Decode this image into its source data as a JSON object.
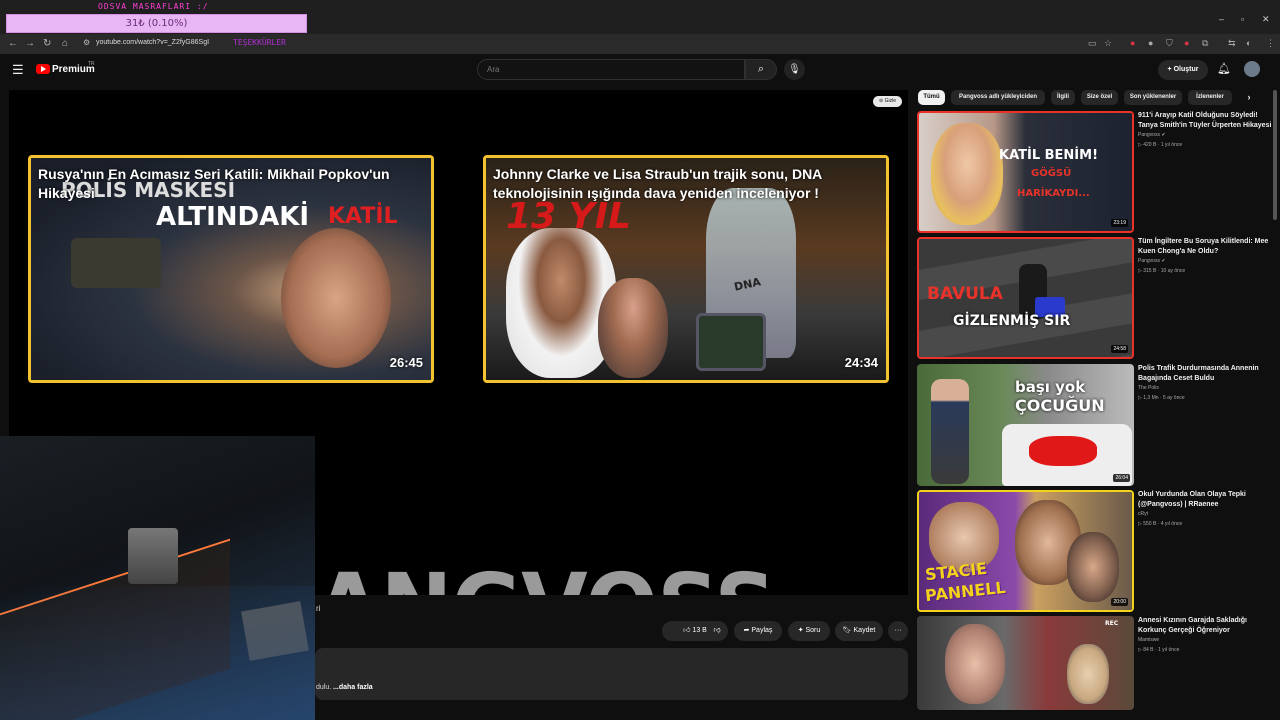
{
  "browser": {
    "overlay_title": "ODSVA MASRAFLARI :/",
    "overlay_progress": "31₺ (0.10%)",
    "overlay_progress_fraction": 0.001,
    "url": "youtube.com/watch?v=_Z2fyG86SgI",
    "url_overlay": "TEŞEKKÜRLER",
    "window_buttons": [
      "–",
      "▫",
      "✕"
    ]
  },
  "header": {
    "logo_text": "Premium",
    "logo_region": "TR",
    "search_placeholder": "Ara",
    "create_label": "Oluştur"
  },
  "player": {
    "hide_label": "Gizle",
    "watermark": "ANGVOSS",
    "endcards": [
      {
        "title": "Rusya'nın En Acımasız Seri Katili: Mikhail Popkov'un Hikayesi",
        "duration": "26:45",
        "art_text_1": "POLİS MASKESİ",
        "art_text_2": "ALTINDAKİ",
        "art_text_3": "KATİL"
      },
      {
        "title": "Johnny Clarke ve Lisa Straub'un trajik sonu, DNA teknolojisinin ışığında dava yeniden inceleniyor !",
        "duration": "24:34",
        "art_text_1": "13 YIL",
        "art_text_2": "DNA"
      }
    ]
  },
  "below_player": {
    "owner_fragment": "ri",
    "like_count": "13 B",
    "share_label": "Paylaş",
    "ask_label": "Soru",
    "save_label": "Kaydet",
    "more_label": "···",
    "desc_fragment": "dulu.",
    "desc_more": "...daha fazla"
  },
  "sidebar": {
    "chips": [
      "Tümü",
      "Pangvoss adlı yükleyiciden",
      "İlgili",
      "Size özel",
      "Son yüklenenler",
      "İzlenenler"
    ],
    "items": [
      {
        "title": "911'i Arayıp Katil Olduğunu Söyledi! Tanya Smith'in Tüyler Ürperten Hikayesi",
        "channel": "Pangvoss ✔",
        "meta": "▷ 420 B  ·  1 yıl önce",
        "duration": "23:19",
        "thumb_text_1": "KATİL BENİM!",
        "thumb_text_2": "GÖĞSÜ",
        "thumb_text_3": "HARİKAYDI..."
      },
      {
        "title": "Tüm İngiltere Bu Soruya Kilitlendi: Mee Kuen Chong'a Ne Oldu?",
        "channel": "Pangvoss ✔",
        "meta": "▷ 315 B  ·  10 ay önce",
        "duration": "24:58",
        "thumb_text_1": "BAVULA",
        "thumb_text_2": "GİZLENMİŞ SIR"
      },
      {
        "title": "Polis Trafik Durdurmasında Annenin Bagajında Ceset Buldu",
        "channel": "The Polis",
        "meta": "▷ 1,3 Mn  ·  5 ay önce",
        "duration": "26:04",
        "thumb_text_1": "başı yok",
        "thumb_text_2": "ÇOCUĞUN"
      },
      {
        "title": "Okul Yurdunda Olan Olaya Tepki (@Pangvoss) | RRaenee",
        "channel": "cRyt",
        "meta": "▷ 550 B  ·  4 yıl önce",
        "duration": "20:00",
        "thumb_text_1": "STACIE",
        "thumb_text_2": "PANNELL"
      },
      {
        "title": "Annesi Kızının Garajda Sakladığı Korkunç Gerçeği Öğreniyor",
        "channel": "Mamiswe",
        "meta": "▷ 84 B  ·  1 yıl önce",
        "duration": "",
        "thumb_text_1": "REC"
      }
    ]
  },
  "colors": {
    "background": "#0f0f0f",
    "endcard_border": "#f2c230",
    "youtube_red": "#ff0000",
    "overlay_pink": "#e8b6f2"
  }
}
